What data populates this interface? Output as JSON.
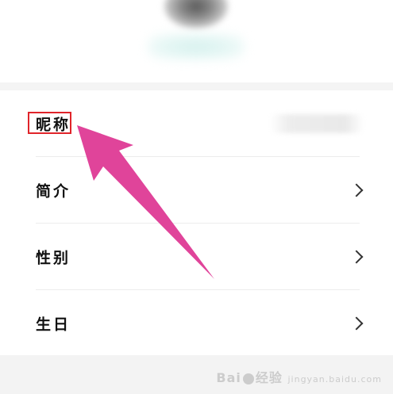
{
  "profile_list": {
    "rows": [
      {
        "label": "昵称"
      },
      {
        "label": "简介"
      },
      {
        "label": "性别"
      },
      {
        "label": "生日"
      }
    ]
  },
  "watermark": {
    "brand": "Bai",
    "brand2": "经验",
    "sub": "jingyan.baidu.com"
  },
  "colors": {
    "annotation_box": "#e0242a",
    "annotation_arrow": "#e0449a"
  }
}
